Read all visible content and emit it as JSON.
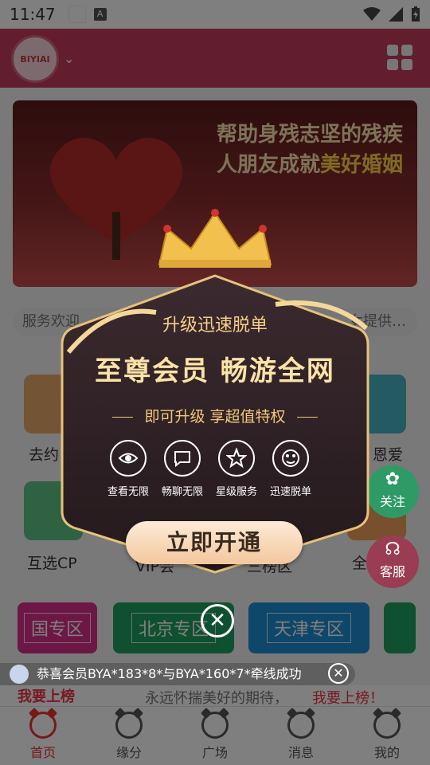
{
  "status_bar": {
    "time": "11:47"
  },
  "header": {
    "logo_text": "BIYIAI"
  },
  "banner": {
    "line1": "帮助身残志坚的残疾",
    "line2_prefix": "人朋友成就",
    "line2_highlight": "美好婚姻"
  },
  "notice": {
    "left": "服务欢迎",
    "right": "女提供…"
  },
  "services": [
    {
      "label": "去约",
      "color": "#e7a969"
    },
    {
      "label": "恩爱",
      "color": "#49b5c4"
    },
    {
      "label": "互选CP",
      "color": "#5fc486"
    },
    {
      "label": "全",
      "color": "#f0a15d"
    }
  ],
  "partial_labels": {
    "vip": "VIP会",
    "ring": "三榜区"
  },
  "regions": [
    {
      "label": "国专区",
      "color": "#d92f8a"
    },
    {
      "label": "北京专区",
      "color": "#1fa160"
    },
    {
      "label": "天津专区",
      "color": "#1e8fd4"
    },
    {
      "label": "",
      "color": "#1fa160"
    }
  ],
  "ticker": {
    "text": "恭喜会员BYA*183*8*与BYA*160*7*牵线成功"
  },
  "under_row": {
    "left": "我要上榜",
    "middle": "永远怀揣美好的期待，",
    "right": "我要上榜！"
  },
  "floats": {
    "follow": "关注",
    "service": "客服"
  },
  "modal": {
    "subtitle": "升级迅速脱单",
    "title": "至尊会员  畅游全网",
    "tagline": "即可升级  享超值特权",
    "features": [
      {
        "label": "查看无限",
        "icon": "eye-icon"
      },
      {
        "label": "畅聊无限",
        "icon": "chat-icon"
      },
      {
        "label": "星级服务",
        "icon": "star-icon"
      },
      {
        "label": "迅速脱单",
        "icon": "love-face-icon"
      }
    ],
    "button": "立即开通"
  },
  "tabs": [
    {
      "label": "首页",
      "active": true
    },
    {
      "label": "缘分",
      "active": false
    },
    {
      "label": "广场",
      "active": false
    },
    {
      "label": "消息",
      "active": false
    },
    {
      "label": "我的",
      "active": false
    }
  ],
  "colors": {
    "header": "#c43d5c",
    "accent": "#e33333",
    "gold": "#fbe3a8"
  }
}
